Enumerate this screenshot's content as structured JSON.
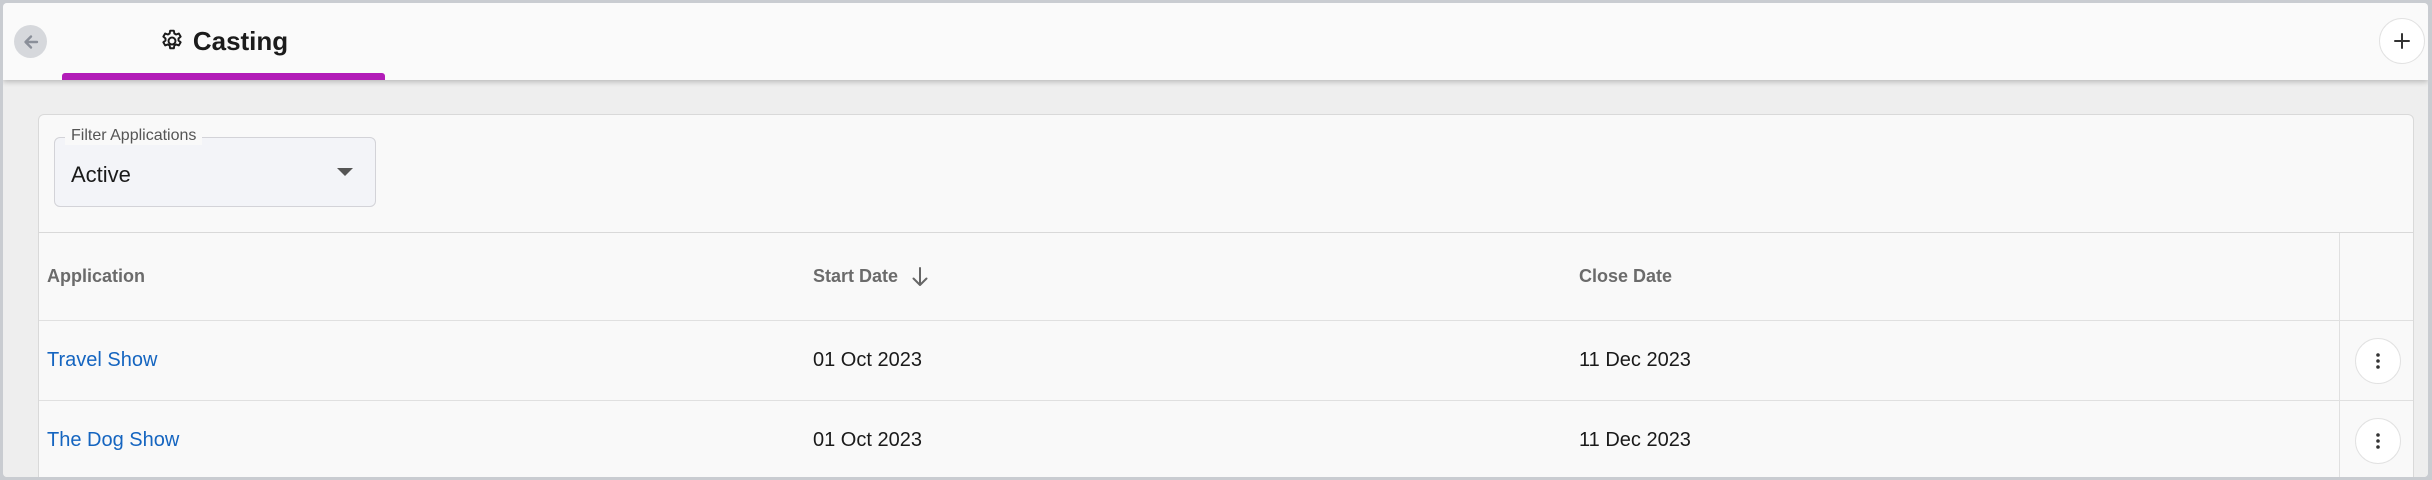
{
  "header": {
    "tab_label": "Casting",
    "accent_color": "#b21cb8",
    "back_icon": "arrow-left-icon",
    "tab_icon": "gear-icon",
    "add_icon": "plus-icon"
  },
  "filter": {
    "label": "Filter Applications",
    "value": "Active"
  },
  "table": {
    "columns": [
      "Application",
      "Start Date",
      "Close Date"
    ],
    "sort": {
      "column": "Start Date",
      "direction": "descending",
      "icon": "arrow-down-icon"
    },
    "rows": [
      {
        "application": "Travel Show",
        "start_date": "01 Oct 2023",
        "close_date": "11 Dec 2023"
      },
      {
        "application": "The Dog Show",
        "start_date": "01 Oct 2023",
        "close_date": "11 Dec 2023"
      }
    ],
    "row_action_icon": "more-vertical-icon",
    "link_color": "#1565c0"
  }
}
